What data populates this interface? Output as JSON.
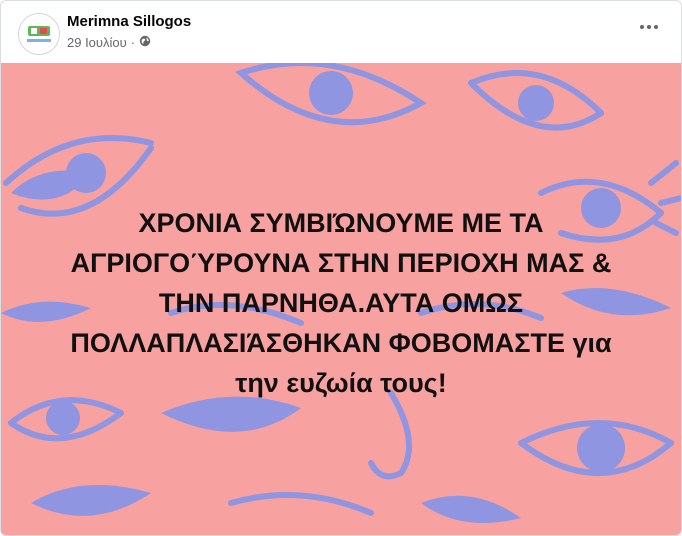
{
  "post": {
    "author": "Merimna Sillogos",
    "date": "29 Ιουλίου",
    "separator": "·",
    "privacy_icon": "globe-icon",
    "more_icon": "more-options-icon"
  },
  "image": {
    "text": "ΧΡΟΝΙΑ ΣΥΜΒΙΏΝΟΥΜΕ ΜΕ ΤΑ\nΑΓΡΙΟΓΟΎΡΟΥΝΑ ΣΤΗΝ ΠΕΡΙΟΧΗ ΜΑΣ &\nΤΗΝ ΠΑΡΝΗΘΑ.ΑΥΤΑ ΟΜΩΣ\nΠΟΛΛΑΠΛΑΣΙΆΣΘΗΚΑΝ ΦΟΒΟΜΑΣΤΕ για\nτην ευζωία τους!",
    "background_color": "#f7a1a0",
    "pattern_color": "#8f95e0"
  }
}
